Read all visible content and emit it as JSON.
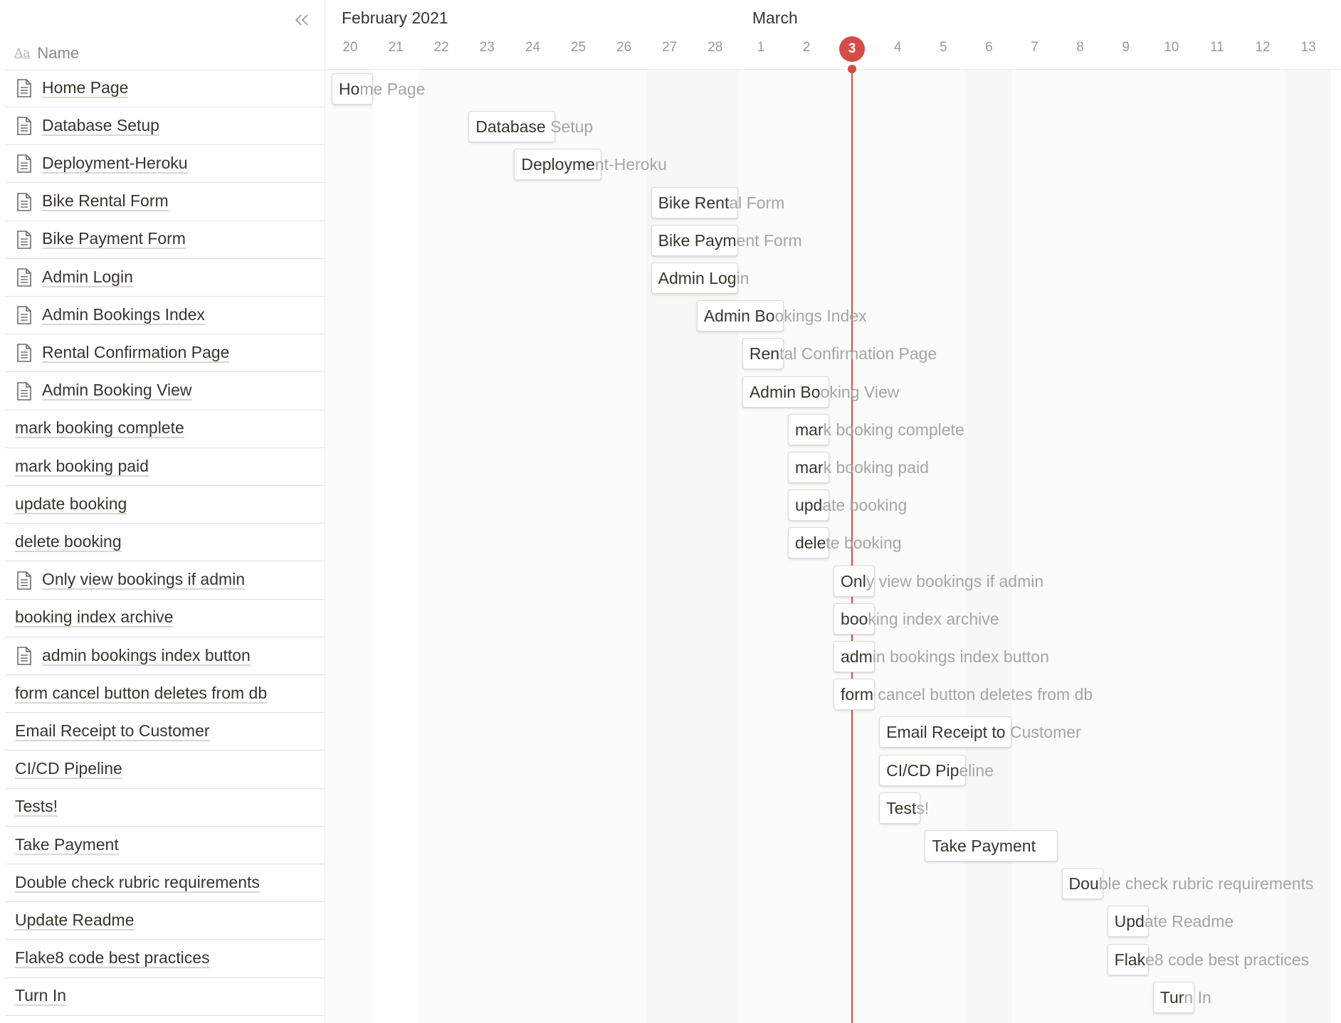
{
  "header": {
    "collapse_icon": "double-chevron-left-icon",
    "name_column_icon": "Aa",
    "name_column_label": "Name"
  },
  "timeline": {
    "months": [
      {
        "label": "February 2021",
        "day_index": 0
      },
      {
        "label": "March",
        "day_index": 9
      }
    ],
    "days": [
      "20",
      "21",
      "22",
      "23",
      "24",
      "25",
      "26",
      "27",
      "28",
      "1",
      "2",
      "3",
      "4",
      "5",
      "6",
      "7",
      "8",
      "9",
      "10",
      "11",
      "12",
      "13"
    ],
    "today": "3",
    "today_index": 11,
    "accent_color": "#d44c47"
  },
  "tasks": [
    {
      "name": "Home Page",
      "icon": true,
      "start": 0,
      "end": 1
    },
    {
      "name": "Database Setup",
      "icon": true,
      "start": 3,
      "end": 5
    },
    {
      "name": "Deployment-Heroku",
      "icon": true,
      "start": 4,
      "end": 6
    },
    {
      "name": "Bike Rental Form",
      "icon": true,
      "start": 7,
      "end": 9
    },
    {
      "name": "Bike Payment Form",
      "icon": true,
      "start": 7,
      "end": 9
    },
    {
      "name": "Admin Login",
      "icon": true,
      "start": 7,
      "end": 9
    },
    {
      "name": "Admin Bookings Index",
      "icon": true,
      "start": 8,
      "end": 10
    },
    {
      "name": "Rental Confirmation Page",
      "icon": true,
      "start": 9,
      "end": 10
    },
    {
      "name": "Admin Booking View",
      "icon": true,
      "start": 9,
      "end": 11
    },
    {
      "name": "mark booking complete",
      "icon": false,
      "start": 10,
      "end": 11
    },
    {
      "name": "mark booking paid",
      "icon": false,
      "start": 10,
      "end": 11
    },
    {
      "name": "update booking",
      "icon": false,
      "start": 10,
      "end": 11
    },
    {
      "name": "delete booking",
      "icon": false,
      "start": 10,
      "end": 11
    },
    {
      "name": "Only view bookings if admin",
      "icon": true,
      "start": 11,
      "end": 12
    },
    {
      "name": "booking index archive",
      "icon": false,
      "start": 11,
      "end": 12
    },
    {
      "name": "admin bookings index button",
      "icon": true,
      "start": 11,
      "end": 12
    },
    {
      "name": "form cancel button deletes from db",
      "icon": false,
      "start": 11,
      "end": 12
    },
    {
      "name": "Email Receipt to Customer",
      "icon": false,
      "start": 12,
      "end": 15
    },
    {
      "name": "CI/CD Pipeline",
      "icon": false,
      "start": 12,
      "end": 14
    },
    {
      "name": "Tests!",
      "icon": false,
      "start": 12,
      "end": 13
    },
    {
      "name": "Take Payment",
      "icon": false,
      "start": 13,
      "end": 16
    },
    {
      "name": "Double check rubric requirements",
      "icon": false,
      "start": 16,
      "end": 17
    },
    {
      "name": "Update Readme",
      "icon": false,
      "start": 17,
      "end": 18
    },
    {
      "name": "Flake8 code best practices",
      "icon": false,
      "start": 17,
      "end": 18
    },
    {
      "name": "Turn In",
      "icon": false,
      "start": 18,
      "end": 19
    }
  ]
}
